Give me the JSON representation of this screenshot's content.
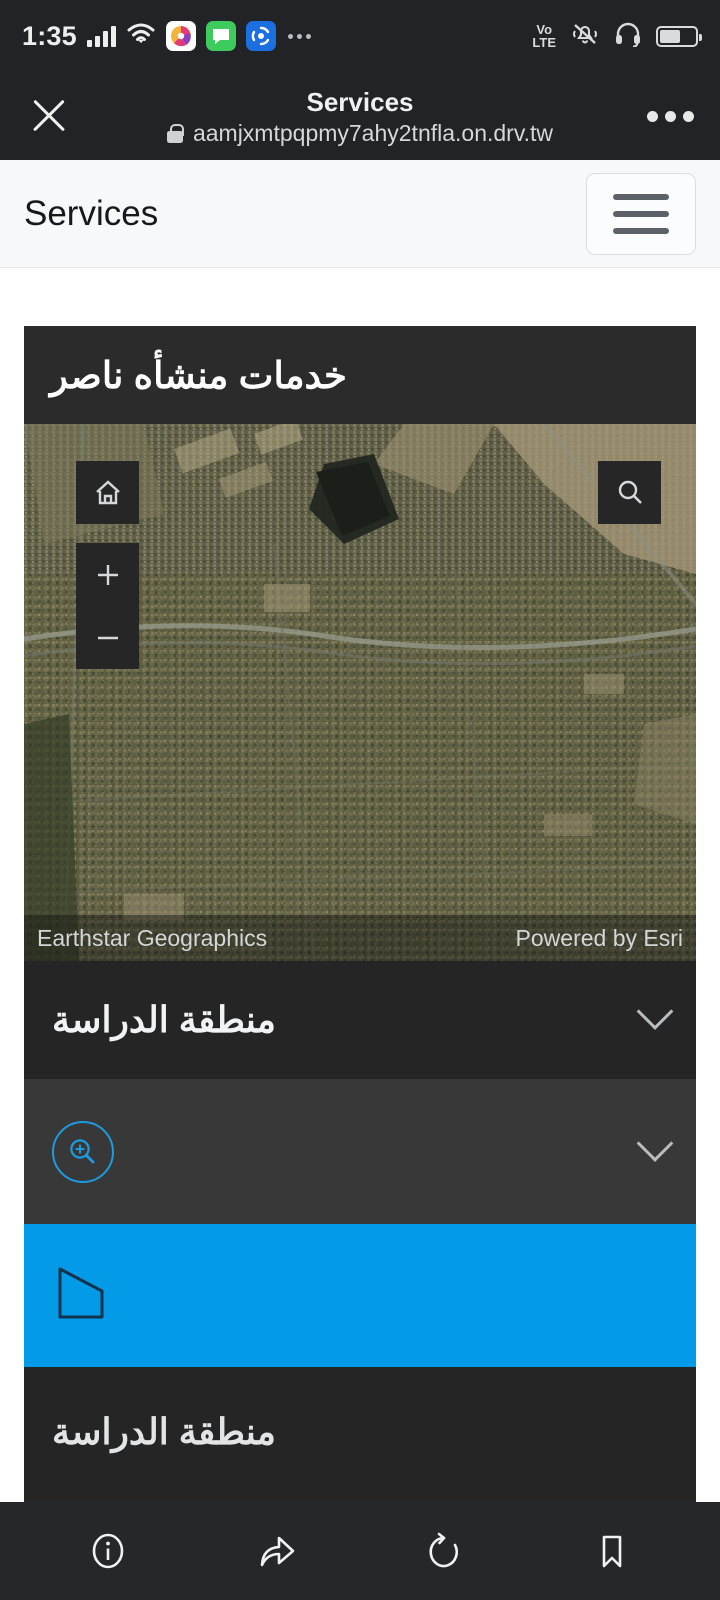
{
  "status_bar": {
    "time": "1:35",
    "signal_icon": "signal-bars-icon",
    "wifi_icon": "wifi-icon",
    "app_icons": [
      "shutter-app-icon",
      "message-app-icon",
      "share-app-icon"
    ],
    "overflow_icon": "more-dots-icon",
    "network_label": "Vo LTE",
    "network_label_top": "Vo",
    "network_label_bottom": "LTE",
    "mute_icon": "bell-muted-icon",
    "headphones_icon": "headphones-icon",
    "battery_icon": "battery-icon",
    "battery_level": 58
  },
  "browser_bar": {
    "close_icon": "close-icon",
    "title": "Services",
    "lock_icon": "lock-icon",
    "url": "aamjxmtpqpmy7ahy2tnfla.on.drv.tw",
    "menu_icon": "more-dots-icon"
  },
  "app_header": {
    "title": "Services",
    "menu_button_icon": "hamburger-menu-icon"
  },
  "card": {
    "title": "خدمات منشأه ناصر"
  },
  "map": {
    "home_icon": "home-icon",
    "zoom_in_icon": "plus-icon",
    "zoom_out_icon": "minus-icon",
    "search_icon": "search-icon",
    "attribution_left": "Earthstar Geographics",
    "attribution_right": "Powered by Esri"
  },
  "panel": {
    "rows": [
      {
        "label": "منطقة الدراسة",
        "icon": "",
        "chevron": "chevron-down-icon",
        "background": "#252525"
      },
      {
        "label": "",
        "icon": "zoom-to-icon",
        "chevron": "chevron-down-icon",
        "background": "#383838"
      },
      {
        "label": "",
        "icon": "polygon-icon",
        "chevron": "",
        "background": "#039ae8"
      },
      {
        "label": "منطقة الدراسة",
        "icon": "",
        "chevron": "",
        "background": "#252525"
      }
    ]
  },
  "bottom_nav": {
    "items": [
      {
        "icon": "info-icon"
      },
      {
        "icon": "share-icon"
      },
      {
        "icon": "refresh-icon"
      },
      {
        "icon": "bookmark-icon"
      }
    ]
  },
  "colors": {
    "accent_blue": "#039ae8",
    "zoom_ring_blue": "#1e9be0",
    "panel_dark": "#252525",
    "panel_mid": "#383838",
    "chrome_dark": "#222326",
    "app_header_bg": "#f6f8fa"
  }
}
